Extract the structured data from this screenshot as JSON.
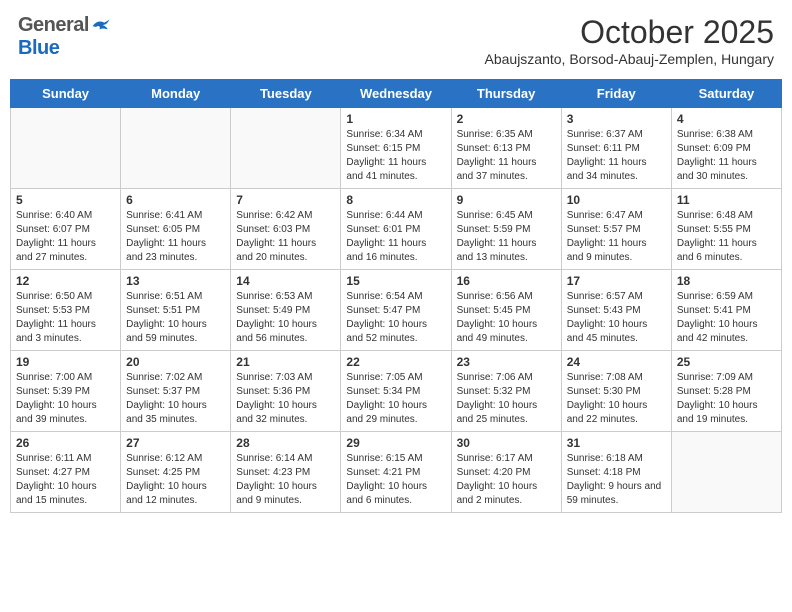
{
  "header": {
    "logo_general": "General",
    "logo_blue": "Blue",
    "month": "October 2025",
    "location": "Abaujszanto, Borsod-Abauj-Zemplen, Hungary"
  },
  "days_of_week": [
    "Sunday",
    "Monday",
    "Tuesday",
    "Wednesday",
    "Thursday",
    "Friday",
    "Saturday"
  ],
  "weeks": [
    [
      {
        "day": "",
        "info": ""
      },
      {
        "day": "",
        "info": ""
      },
      {
        "day": "",
        "info": ""
      },
      {
        "day": "1",
        "info": "Sunrise: 6:34 AM\nSunset: 6:15 PM\nDaylight: 11 hours and 41 minutes."
      },
      {
        "day": "2",
        "info": "Sunrise: 6:35 AM\nSunset: 6:13 PM\nDaylight: 11 hours and 37 minutes."
      },
      {
        "day": "3",
        "info": "Sunrise: 6:37 AM\nSunset: 6:11 PM\nDaylight: 11 hours and 34 minutes."
      },
      {
        "day": "4",
        "info": "Sunrise: 6:38 AM\nSunset: 6:09 PM\nDaylight: 11 hours and 30 minutes."
      }
    ],
    [
      {
        "day": "5",
        "info": "Sunrise: 6:40 AM\nSunset: 6:07 PM\nDaylight: 11 hours and 27 minutes."
      },
      {
        "day": "6",
        "info": "Sunrise: 6:41 AM\nSunset: 6:05 PM\nDaylight: 11 hours and 23 minutes."
      },
      {
        "day": "7",
        "info": "Sunrise: 6:42 AM\nSunset: 6:03 PM\nDaylight: 11 hours and 20 minutes."
      },
      {
        "day": "8",
        "info": "Sunrise: 6:44 AM\nSunset: 6:01 PM\nDaylight: 11 hours and 16 minutes."
      },
      {
        "day": "9",
        "info": "Sunrise: 6:45 AM\nSunset: 5:59 PM\nDaylight: 11 hours and 13 minutes."
      },
      {
        "day": "10",
        "info": "Sunrise: 6:47 AM\nSunset: 5:57 PM\nDaylight: 11 hours and 9 minutes."
      },
      {
        "day": "11",
        "info": "Sunrise: 6:48 AM\nSunset: 5:55 PM\nDaylight: 11 hours and 6 minutes."
      }
    ],
    [
      {
        "day": "12",
        "info": "Sunrise: 6:50 AM\nSunset: 5:53 PM\nDaylight: 11 hours and 3 minutes."
      },
      {
        "day": "13",
        "info": "Sunrise: 6:51 AM\nSunset: 5:51 PM\nDaylight: 10 hours and 59 minutes."
      },
      {
        "day": "14",
        "info": "Sunrise: 6:53 AM\nSunset: 5:49 PM\nDaylight: 10 hours and 56 minutes."
      },
      {
        "day": "15",
        "info": "Sunrise: 6:54 AM\nSunset: 5:47 PM\nDaylight: 10 hours and 52 minutes."
      },
      {
        "day": "16",
        "info": "Sunrise: 6:56 AM\nSunset: 5:45 PM\nDaylight: 10 hours and 49 minutes."
      },
      {
        "day": "17",
        "info": "Sunrise: 6:57 AM\nSunset: 5:43 PM\nDaylight: 10 hours and 45 minutes."
      },
      {
        "day": "18",
        "info": "Sunrise: 6:59 AM\nSunset: 5:41 PM\nDaylight: 10 hours and 42 minutes."
      }
    ],
    [
      {
        "day": "19",
        "info": "Sunrise: 7:00 AM\nSunset: 5:39 PM\nDaylight: 10 hours and 39 minutes."
      },
      {
        "day": "20",
        "info": "Sunrise: 7:02 AM\nSunset: 5:37 PM\nDaylight: 10 hours and 35 minutes."
      },
      {
        "day": "21",
        "info": "Sunrise: 7:03 AM\nSunset: 5:36 PM\nDaylight: 10 hours and 32 minutes."
      },
      {
        "day": "22",
        "info": "Sunrise: 7:05 AM\nSunset: 5:34 PM\nDaylight: 10 hours and 29 minutes."
      },
      {
        "day": "23",
        "info": "Sunrise: 7:06 AM\nSunset: 5:32 PM\nDaylight: 10 hours and 25 minutes."
      },
      {
        "day": "24",
        "info": "Sunrise: 7:08 AM\nSunset: 5:30 PM\nDaylight: 10 hours and 22 minutes."
      },
      {
        "day": "25",
        "info": "Sunrise: 7:09 AM\nSunset: 5:28 PM\nDaylight: 10 hours and 19 minutes."
      }
    ],
    [
      {
        "day": "26",
        "info": "Sunrise: 6:11 AM\nSunset: 4:27 PM\nDaylight: 10 hours and 15 minutes."
      },
      {
        "day": "27",
        "info": "Sunrise: 6:12 AM\nSunset: 4:25 PM\nDaylight: 10 hours and 12 minutes."
      },
      {
        "day": "28",
        "info": "Sunrise: 6:14 AM\nSunset: 4:23 PM\nDaylight: 10 hours and 9 minutes."
      },
      {
        "day": "29",
        "info": "Sunrise: 6:15 AM\nSunset: 4:21 PM\nDaylight: 10 hours and 6 minutes."
      },
      {
        "day": "30",
        "info": "Sunrise: 6:17 AM\nSunset: 4:20 PM\nDaylight: 10 hours and 2 minutes."
      },
      {
        "day": "31",
        "info": "Sunrise: 6:18 AM\nSunset: 4:18 PM\nDaylight: 9 hours and 59 minutes."
      },
      {
        "day": "",
        "info": ""
      }
    ]
  ]
}
